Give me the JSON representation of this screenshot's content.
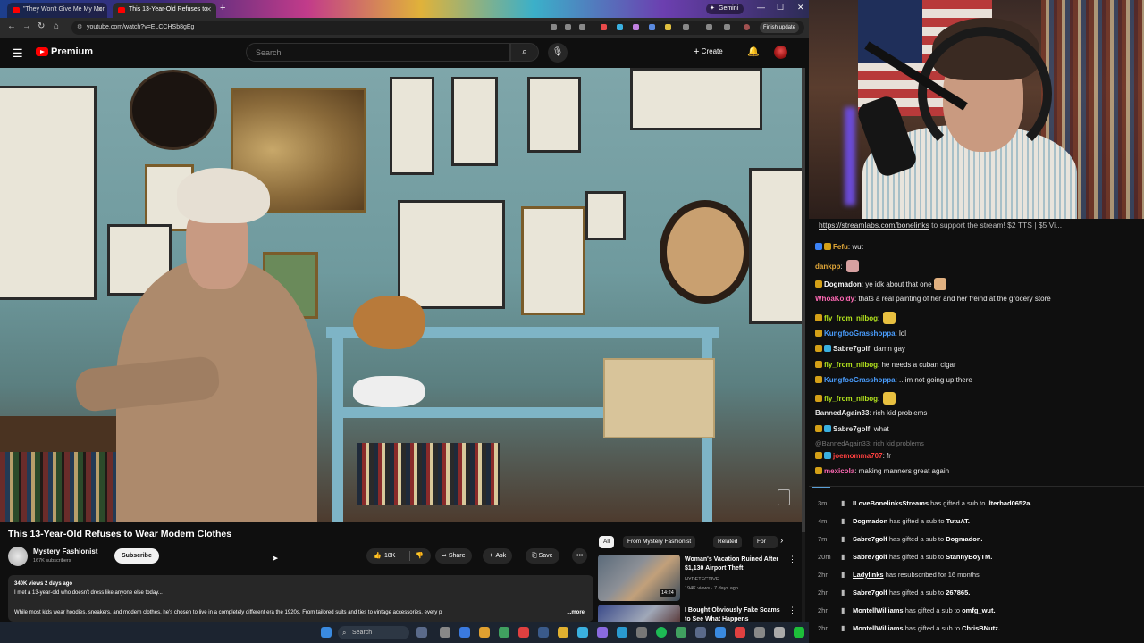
{
  "browser": {
    "tabs": [
      {
        "label": "\"They Won't Give Me My Mon",
        "active": false
      },
      {
        "label": "This 13-Year-Old Refuses to",
        "active": true
      }
    ],
    "gemini_label": "Gemini",
    "url": "youtube.com/watch?v=ELCCHSb8gEg",
    "finish_update_label": "Finish update"
  },
  "youtube": {
    "brand": "Premium",
    "search_placeholder": "Search",
    "create_label": "Create",
    "video": {
      "title": "This 13-Year-Old Refuses to Wear Modern Clothes",
      "channel": "Mystery Fashionist",
      "subscribers": "167K subscribers",
      "subscribe_label": "Subscribe",
      "likes": "18K",
      "share_label": "Share",
      "ask_label": "Ask",
      "save_label": "Save",
      "views_date": "340K views  2 days ago",
      "description_line1": "I met a 13-year-old who doesn't dress like anyone else today...",
      "description_line2": "While most kids wear hoodies, sneakers, and modern clothes, he's chosen to live in a completely different era the 1920s. From tailored suits and ties to vintage accessories, every p",
      "more_label": "...more"
    },
    "chips": [
      "All",
      "From Mystery Fashionist",
      "Related",
      "For"
    ],
    "recommendations": [
      {
        "title": "Woman's Vacation Ruined After $1,130 Airport Theft",
        "channel": "NYDETECTIVE",
        "views": "194K views · 7 days ago",
        "duration": "14:24"
      },
      {
        "title": "I Bought Obviously Fake Scams to See What Happens",
        "channel": "",
        "views": "",
        "duration": ""
      }
    ]
  },
  "stream": {
    "ticker_link": "https://streamlabs.com/bonelinks",
    "ticker_rest": " to support the stream! $2 TTS | $5 Vi...",
    "chat": [
      {
        "user": "Fefu",
        "text": "wut",
        "color": "#e2a83a",
        "badges": [
          "#3b82f6",
          "#d4a017"
        ]
      },
      {
        "user": "dankpp",
        "text": "",
        "color": "#e2a83a",
        "badges": [],
        "emote": "#d6a0a0"
      },
      {
        "user": "Dogmadon",
        "text": "ye idk about that one",
        "color": "#ffffff",
        "badges": [
          "#d4a017"
        ],
        "emote": "#e0b080"
      },
      {
        "user": "WhoaKoldy",
        "text": "thats a real painting of her and her freind at the grocery store",
        "color": "#ff69b4",
        "badges": []
      },
      {
        "user": "fly_from_nilbog",
        "text": "",
        "color": "#b5e61d",
        "badges": [
          "#d4a017"
        ],
        "emote": "#e8c040"
      },
      {
        "user": "KungfooGrasshoppa",
        "text": "lol",
        "color": "#4a9eff",
        "badges": [
          "#d4a017"
        ]
      },
      {
        "user": "Sabre7golf",
        "text": "damn gay",
        "color": "#e8e8e8",
        "badges": [
          "#d4a017",
          "#3ab0e0"
        ]
      },
      {
        "user": "fly_from_nilbog",
        "text": "he needs a cuban cigar",
        "color": "#b5e61d",
        "badges": [
          "#d4a017"
        ]
      },
      {
        "user": "KungfooGrasshoppa",
        "text": "...im not going up there",
        "color": "#4a9eff",
        "badges": [
          "#d4a017"
        ]
      },
      {
        "user": "fly_from_nilbog",
        "text": "",
        "color": "#b5e61d",
        "badges": [
          "#d4a017"
        ],
        "emote": "#e8c040"
      },
      {
        "user": "BannedAgain33",
        "text": "rich kid problems",
        "color": "#e8e8e8",
        "badges": []
      },
      {
        "user": "Sabre7golf",
        "text": "what",
        "color": "#e8e8e8",
        "badges": [
          "#d4a017",
          "#3ab0e0"
        ]
      },
      {
        "user": "",
        "text": "@BannedAgain33: rich kid problems",
        "color": "#777777",
        "badges": [],
        "reply": true
      },
      {
        "user": "joemomma707",
        "text": "fr",
        "color": "#ff4040",
        "badges": [
          "#d4a017",
          "#3ab0e0"
        ]
      },
      {
        "user": "mexicola",
        "text": "making manners great again",
        "color": "#ff69b4",
        "badges": [
          "#d4a017"
        ]
      }
    ],
    "events": [
      {
        "time": "3m",
        "user": "ILoveBonelinksStreams",
        "text": " has gifted a sub to ",
        "target": "ilterbad0652a."
      },
      {
        "time": "4m",
        "user": "Dogmadon",
        "text": " has gifted a sub to ",
        "target": "TutuAT."
      },
      {
        "time": "7m",
        "user": "Sabre7golf",
        "text": " has gifted a sub to ",
        "target": "Dogmadon."
      },
      {
        "time": "20m",
        "user": "Sabre7golf",
        "text": " has gifted a sub to ",
        "target": "StannyBoyTM."
      },
      {
        "time": "2hr",
        "user": "Ladylinks",
        "text": " has resubscribed for 16 months",
        "target": ""
      },
      {
        "time": "2hr",
        "user": "Sabre7golf",
        "text": " has gifted a sub to ",
        "target": "267865."
      },
      {
        "time": "2hr",
        "user": "MontellWilliams",
        "text": " has gifted a sub to ",
        "target": "omfg_wut."
      },
      {
        "time": "2hr",
        "user": "MontellWilliams",
        "text": " has gifted a sub to ",
        "target": "ChrisBNutz."
      }
    ]
  },
  "taskbar": {
    "search_placeholder": "Search"
  },
  "colors": {
    "youtube_red": "#ff0000",
    "background": "#0f0f0f",
    "chip_bg": "#272727"
  }
}
